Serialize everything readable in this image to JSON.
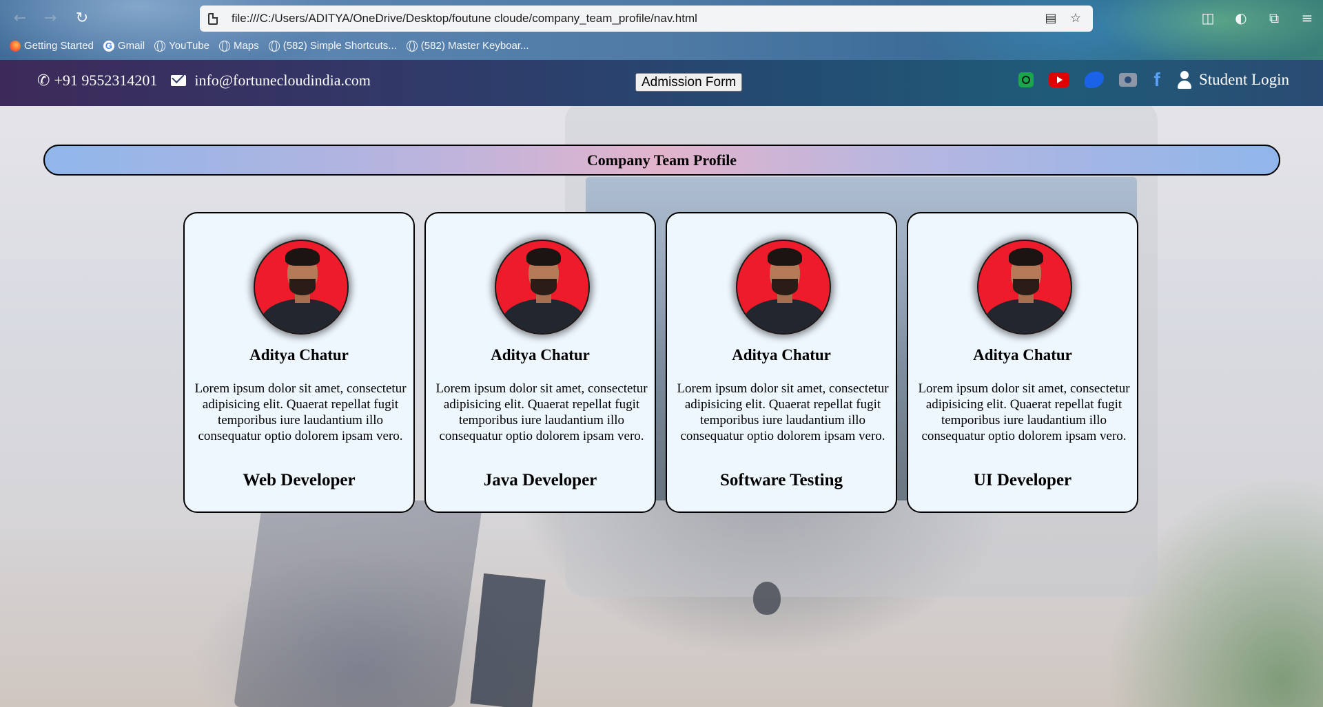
{
  "browser": {
    "url": "file:///C:/Users/ADITYA/OneDrive/Desktop/foutune cloude/company_team_profile/nav.html",
    "bookmarks": [
      {
        "label": "Getting Started",
        "icon": "firefox-icon"
      },
      {
        "label": "Gmail",
        "icon": "google-icon"
      },
      {
        "label": "YouTube",
        "icon": "globe-icon"
      },
      {
        "label": "Maps",
        "icon": "globe-icon"
      },
      {
        "label": "(582) Simple Shortcuts...",
        "icon": "globe-icon"
      },
      {
        "label": "(582) Master Keyboar...",
        "icon": "globe-icon"
      }
    ]
  },
  "header": {
    "phone": "+91 9552314201",
    "email": "info@fortunecloudindia.com",
    "admission_button": "Admission Form",
    "social_icons": [
      "whatsapp-icon",
      "youtube-icon",
      "twitter-icon",
      "camera-icon",
      "facebook-icon"
    ],
    "student_login": "Student Login",
    "colors": {
      "whatsapp": "#1aa64a",
      "youtube": "#e00000",
      "twitter": "#1a62e8",
      "facebook": "#5aa0ff"
    }
  },
  "main": {
    "title": "Company Team Profile",
    "cards": [
      {
        "name": "Aditya Chatur",
        "description": "Lorem ipsum dolor sit amet, consectetur adipisicing elit. Quaerat repellat fugit temporibus iure laudantium illo consequatur optio dolorem ipsam vero.",
        "role": "Web Developer"
      },
      {
        "name": "Aditya Chatur",
        "description": "Lorem ipsum dolor sit amet, consectetur adipisicing elit. Quaerat repellat fugit temporibus iure laudantium illo consequatur optio dolorem ipsam vero.",
        "role": "Java Developer"
      },
      {
        "name": "Aditya Chatur",
        "description": "Lorem ipsum dolor sit amet, consectetur adipisicing elit. Quaerat repellat fugit temporibus iure laudantium illo consequatur optio dolorem ipsam vero.",
        "role": "Software Testing"
      },
      {
        "name": "Aditya Chatur",
        "description": "Lorem ipsum dolor sit amet, consectetur adipisicing elit. Quaerat repellat fugit temporibus iure laudantium illo consequatur optio dolorem ipsam vero.",
        "role": "UI Developer"
      }
    ]
  }
}
